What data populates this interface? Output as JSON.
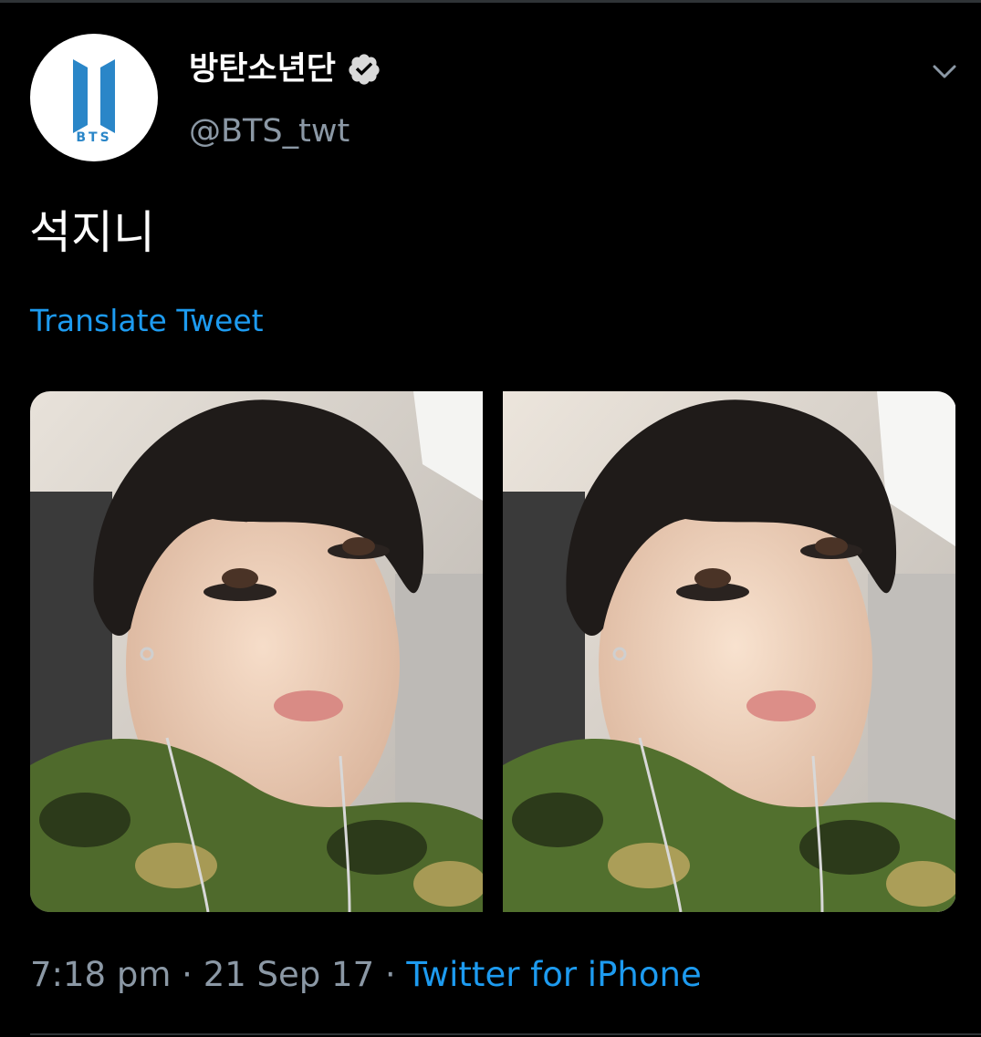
{
  "author": {
    "display_name": "방탄소년단",
    "handle": "@BTS_twt",
    "verified": true,
    "avatar_logo_text": "BTS"
  },
  "tweet": {
    "text": "석지니",
    "translate_label": "Translate Tweet",
    "time": "7:18 pm",
    "date": "21 Sep 17",
    "separator": "·",
    "source": "Twitter for iPhone"
  },
  "icons": {
    "verified": "verified-badge-icon",
    "more": "chevron-down-icon"
  },
  "media": {
    "count": 2
  },
  "colors": {
    "background": "#000000",
    "link": "#1d9bf0",
    "secondary_text": "#8b98a5",
    "logo_blue": "#2a86c8"
  }
}
